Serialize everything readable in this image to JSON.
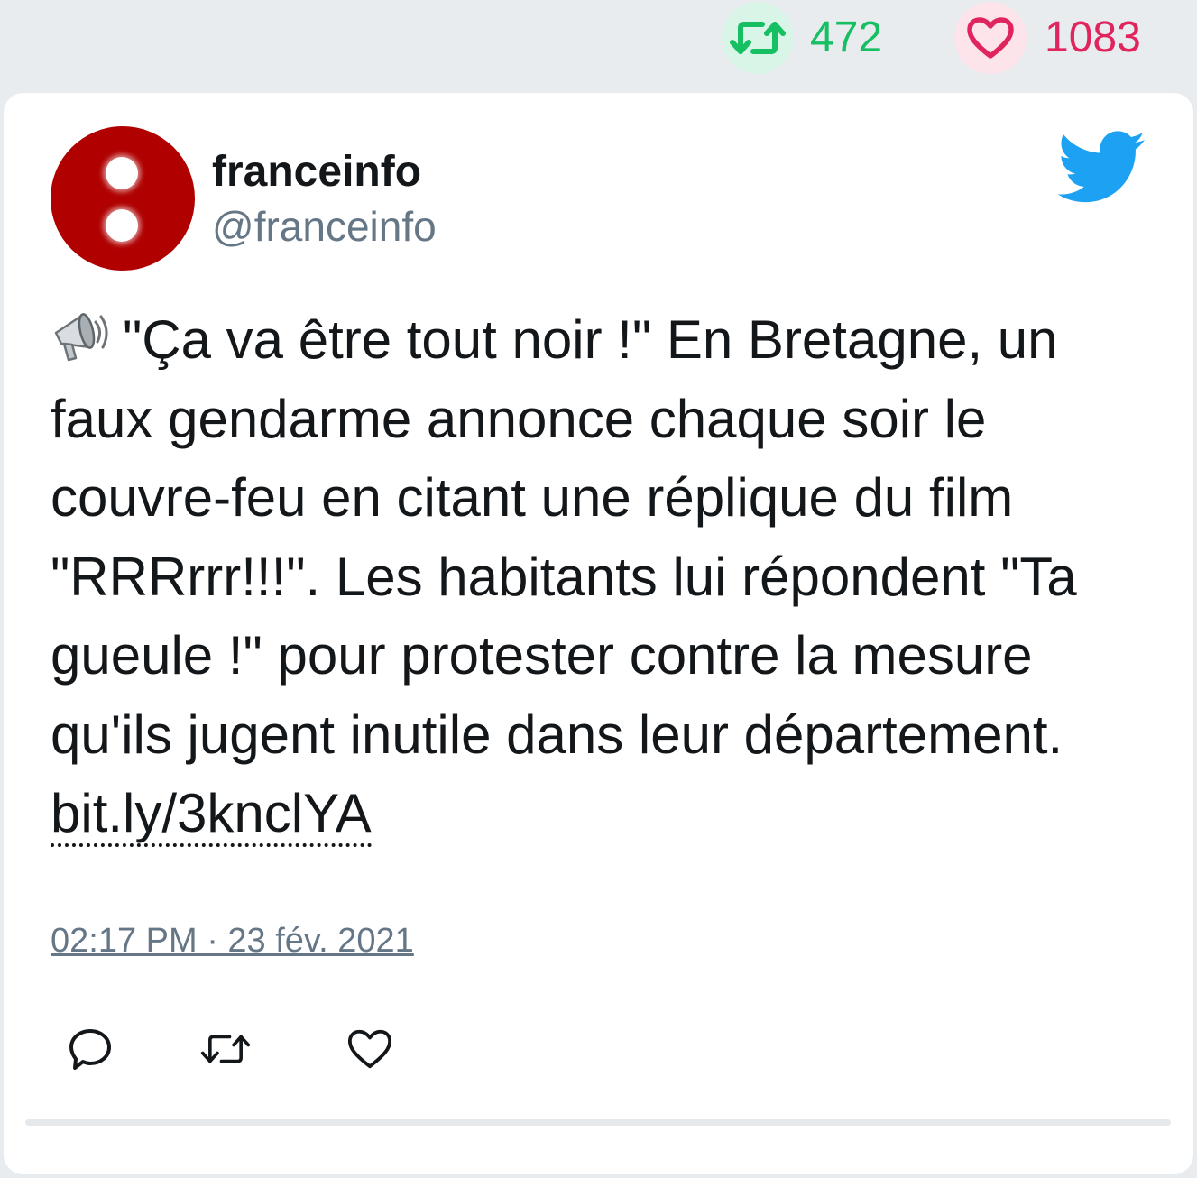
{
  "stats": {
    "retweets": "472",
    "likes": "1083",
    "retweet_icon": "retweet-icon",
    "like_icon": "heart-icon",
    "retweet_color": "#17bf63",
    "like_color": "#e0245e"
  },
  "author": {
    "name": "franceinfo",
    "handle": "@franceinfo",
    "avatar_color": "#b00000"
  },
  "brand": {
    "logo_icon": "twitter-bird-icon",
    "color": "#1da1f2"
  },
  "tweet": {
    "emoji_icon": "megaphone-icon",
    "text": "\"Ça va être tout noir !\" En Bretagne, un faux gendarme annonce chaque soir le couvre-feu en citant une réplique du film \"RRRrrr!!!\". Les habitants lui répondent \"Ta gueule !\" pour protester contre la mesure qu'ils jugent inutile dans leur département.",
    "link": "bit.ly/3knclYA",
    "timestamp": "02:17 PM · 23 fév. 2021"
  },
  "actions": [
    {
      "name": "reply",
      "icon": "reply-icon"
    },
    {
      "name": "retweet",
      "icon": "retweet-icon"
    },
    {
      "name": "like",
      "icon": "heart-icon"
    }
  ]
}
